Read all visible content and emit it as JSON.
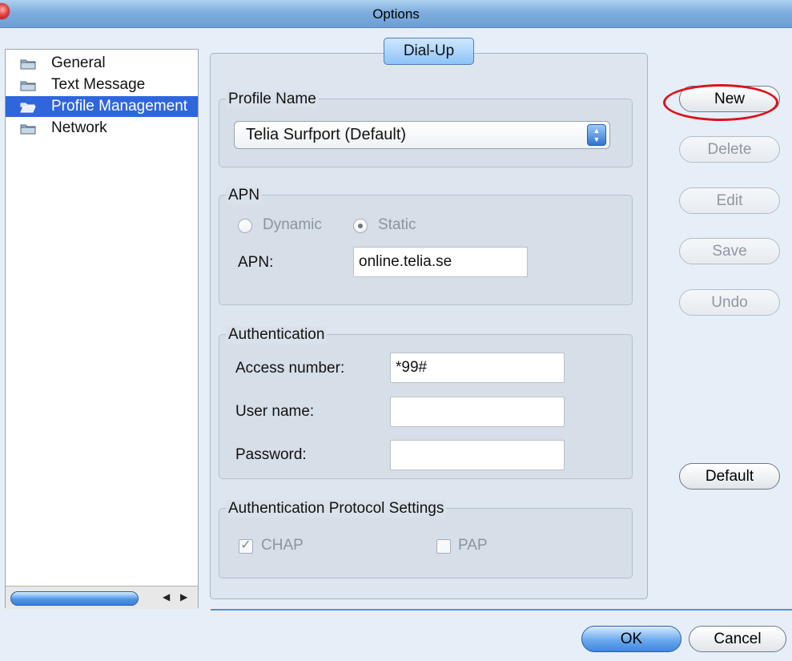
{
  "window": {
    "title": "Options"
  },
  "sidebar": {
    "items": [
      {
        "label": "General",
        "selected": false
      },
      {
        "label": "Text Message",
        "selected": false
      },
      {
        "label": "Profile Management",
        "selected": true
      },
      {
        "label": "Network",
        "selected": false
      }
    ]
  },
  "tab": {
    "label": "Dial-Up"
  },
  "profile": {
    "group_title": "Profile Name",
    "selected_profile": "Telia Surfport (Default)"
  },
  "apn": {
    "group_title": "APN",
    "dynamic_label": "Dynamic",
    "static_label": "Static",
    "selected_mode": "Static",
    "apn_label": "APN:",
    "apn_value": "online.telia.se"
  },
  "auth": {
    "group_title": "Authentication",
    "access_number_label": "Access number:",
    "access_number_value": "*99#",
    "user_name_label": "User name:",
    "user_name_value": "",
    "password_label": "Password:",
    "password_value": ""
  },
  "protocol": {
    "group_title": "Authentication Protocol Settings",
    "chap_label": "CHAP",
    "chap_checked": true,
    "pap_label": "PAP",
    "pap_checked": false
  },
  "actions": {
    "new_label": "New",
    "delete_label": "Delete",
    "edit_label": "Edit",
    "save_label": "Save",
    "undo_label": "Undo",
    "default_label": "Default"
  },
  "footer": {
    "ok_label": "OK",
    "cancel_label": "Cancel"
  },
  "colors": {
    "selection": "#2f66dc",
    "highlight": "#e0101a",
    "accent": "#4e95e6"
  }
}
